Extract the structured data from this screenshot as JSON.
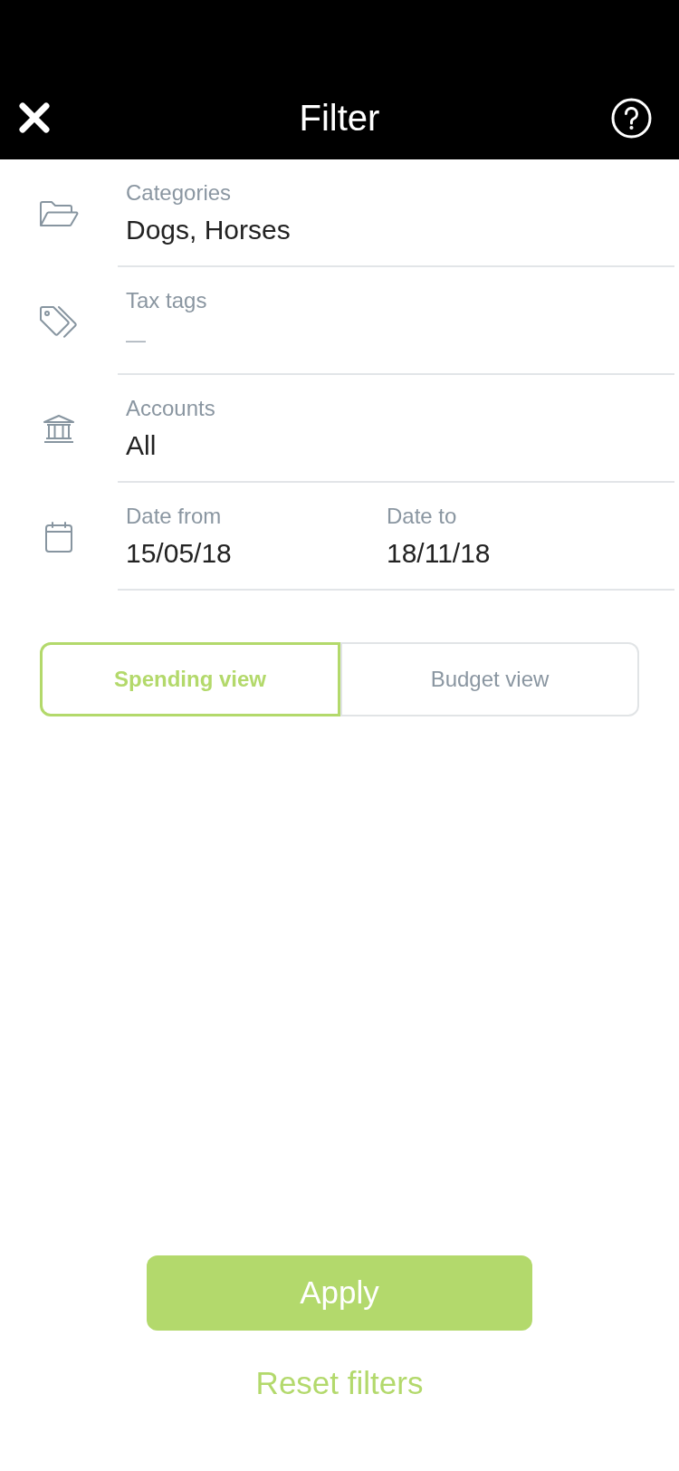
{
  "header": {
    "title": "Filter"
  },
  "filters": [
    {
      "kind": "categories",
      "fields": [
        {
          "label": "Categories",
          "value": "Dogs, Horses"
        }
      ]
    },
    {
      "kind": "tax_tags",
      "fields": [
        {
          "label": "Tax tags",
          "placeholder": "—"
        }
      ]
    },
    {
      "kind": "accounts",
      "fields": [
        {
          "label": "Accounts",
          "value": "All"
        }
      ]
    },
    {
      "kind": "date_range",
      "fields": [
        {
          "label": "Date from",
          "value": "15/05/18"
        },
        {
          "label": "Date to",
          "value": "18/11/18"
        }
      ]
    }
  ],
  "view_toggle": [
    {
      "label": "Spending view",
      "selected": true
    },
    {
      "label": "Budget view",
      "selected": false
    }
  ],
  "apply_button": "Apply",
  "reset_link": "Reset filters"
}
